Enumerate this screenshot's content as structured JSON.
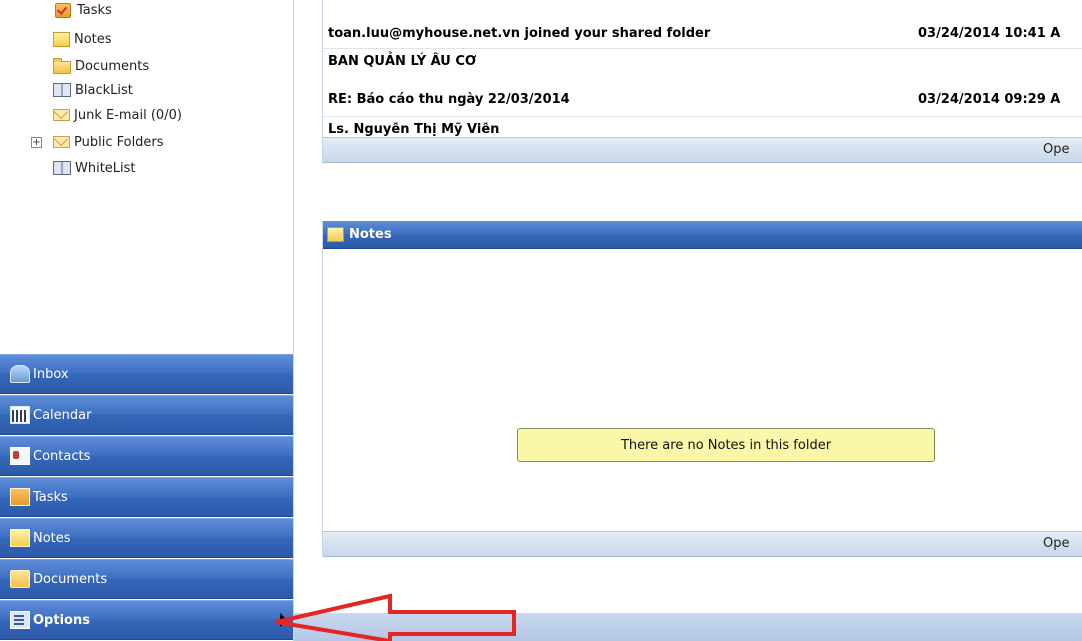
{
  "folders": [
    {
      "label": "Tasks",
      "icon": "tasks-icon"
    },
    {
      "label": "Notes",
      "icon": "notes-icon"
    },
    {
      "label": "Documents",
      "icon": "folder-icon"
    },
    {
      "label": "BlackList",
      "icon": "address-book-icon"
    },
    {
      "label": "Junk E-mail (0/0)",
      "icon": "mail-icon"
    },
    {
      "label": "Public Folders",
      "icon": "mail-icon",
      "expander": "+"
    },
    {
      "label": "WhiteList",
      "icon": "address-book-icon"
    }
  ],
  "nav": [
    {
      "label": "Inbox",
      "icon": "inbox-icon"
    },
    {
      "label": "Calendar",
      "icon": "calendar-icon"
    },
    {
      "label": "Contacts",
      "icon": "contacts-icon"
    },
    {
      "label": "Tasks",
      "icon": "tasks-icon"
    },
    {
      "label": "Notes",
      "icon": "notes-icon"
    },
    {
      "label": "Documents",
      "icon": "documents-icon"
    },
    {
      "label": "Options",
      "icon": "options-icon"
    }
  ],
  "mail": {
    "rows": [
      {
        "subject": "toan.luu@myhouse.net.vn joined your shared folder",
        "date": "03/24/2014 10:41 A"
      },
      {
        "subject": "BAN QUẢN LÝ ÂU CƠ",
        "date": ""
      },
      {
        "subject": "RE: Báo cáo thu ngày 22/03/2014",
        "date": "03/24/2014 09:29 A"
      },
      {
        "subject": "Ls. Nguyễn Thị Mỹ Viễn",
        "date": ""
      }
    ],
    "footer_link": "Ope"
  },
  "notes_panel": {
    "title": "Notes",
    "empty_message": "There are no Notes in this folder",
    "footer_link": "Ope"
  },
  "colors": {
    "nav_blue": "#3466b9",
    "annotation_red": "#e52424",
    "message_yellow": "#fbf7a9"
  }
}
